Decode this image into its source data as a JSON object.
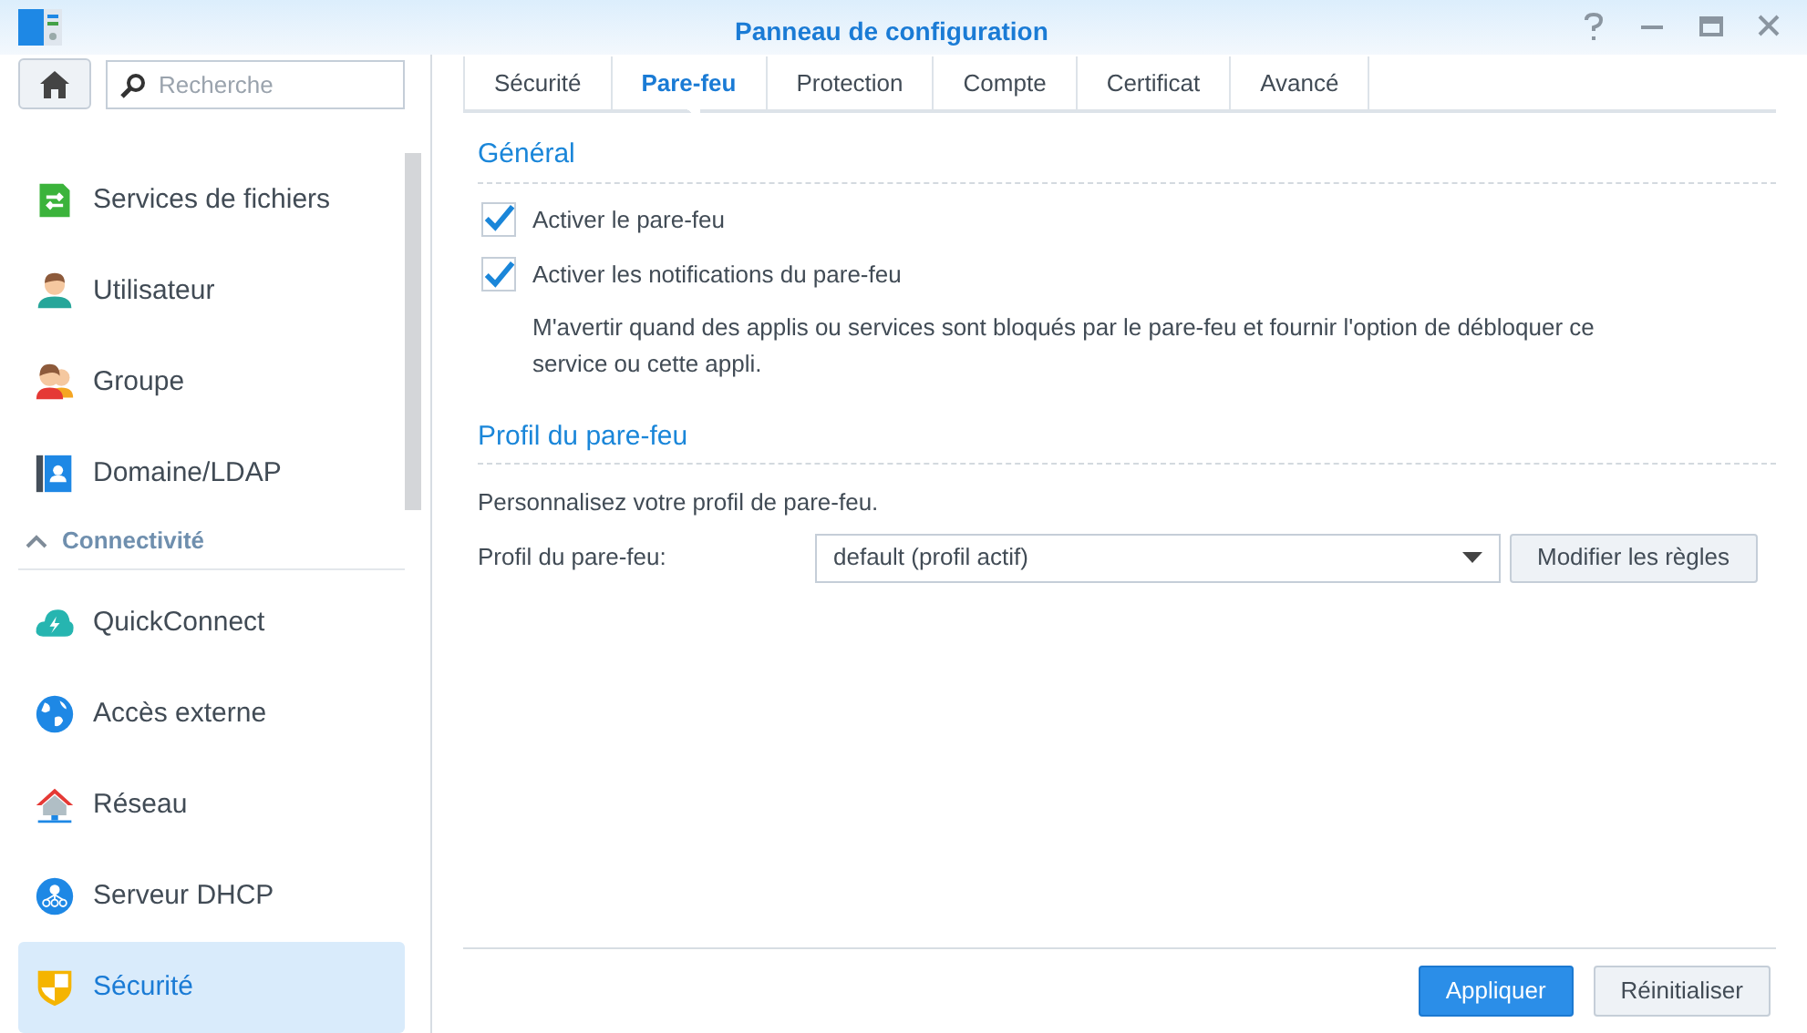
{
  "window": {
    "title": "Panneau de configuration"
  },
  "search": {
    "placeholder": "Recherche"
  },
  "sidebar": {
    "items": [
      {
        "kind": "item",
        "label": "Services de fichiers",
        "selected": false
      },
      {
        "kind": "item",
        "label": "Utilisateur",
        "selected": false
      },
      {
        "kind": "item",
        "label": "Groupe",
        "selected": false
      },
      {
        "kind": "item",
        "label": "Domaine/LDAP",
        "selected": false
      },
      {
        "kind": "header",
        "label": "Connectivité",
        "expanded": true
      },
      {
        "kind": "item",
        "label": "QuickConnect",
        "selected": false
      },
      {
        "kind": "item",
        "label": "Accès externe",
        "selected": false
      },
      {
        "kind": "item",
        "label": "Réseau",
        "selected": false
      },
      {
        "kind": "item",
        "label": "Serveur DHCP",
        "selected": false
      },
      {
        "kind": "item",
        "label": "Sécurité",
        "selected": true
      }
    ]
  },
  "tabs": [
    {
      "label": "Sécurité",
      "selected": false
    },
    {
      "label": "Pare-feu",
      "selected": true
    },
    {
      "label": "Protection",
      "selected": false
    },
    {
      "label": "Compte",
      "selected": false
    },
    {
      "label": "Certificat",
      "selected": false
    },
    {
      "label": "Avancé",
      "selected": false
    }
  ],
  "general": {
    "title": "Général",
    "options": [
      {
        "label": "Activer le pare-feu",
        "checked": true
      },
      {
        "label": "Activer les notifications du pare-feu",
        "checked": true
      }
    ],
    "note": "M'avertir quand des applis ou services sont bloqués par le pare-feu et fournir l'option de débloquer ce service ou cette appli."
  },
  "profile": {
    "title": "Profil du pare-feu",
    "description": "Personnalisez votre profil de pare-feu.",
    "field_label": "Profil du pare-feu:",
    "value": "default (profil actif)",
    "button": "Modifier les règles"
  },
  "footer": {
    "buttons": [
      {
        "label": "Appliquer",
        "kind": "primary"
      },
      {
        "label": "Réinitialiser",
        "kind": "secondary"
      }
    ]
  }
}
